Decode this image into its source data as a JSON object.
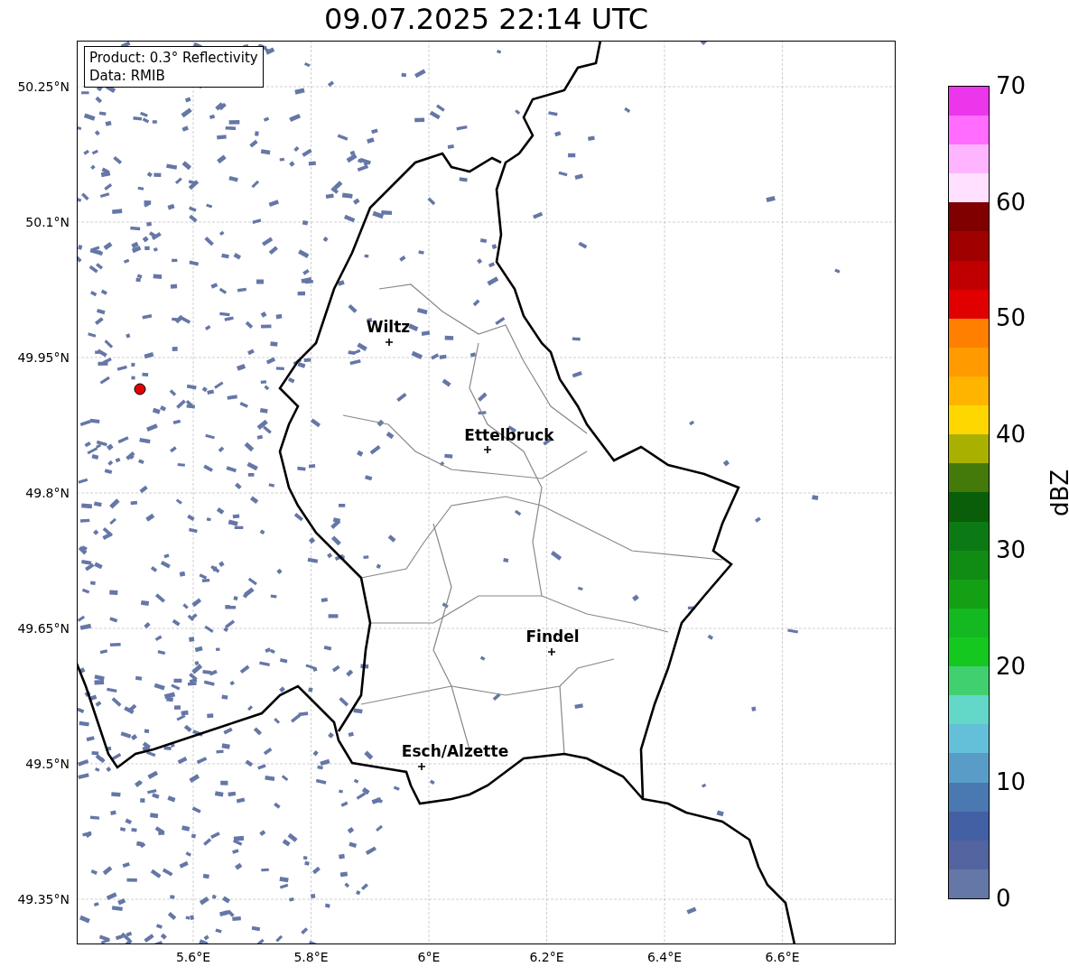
{
  "title": "09.07.2025 22:14 UTC",
  "info_box": [
    "Product: 0.3° Reflectivity",
    "Data: RMIB"
  ],
  "y_ticks": [
    "50.25°N",
    "50.1°N",
    "49.95°N",
    "49.8°N",
    "49.65°N",
    "49.5°N",
    "49.35°N"
  ],
  "x_ticks": [
    "5.6°E",
    "5.8°E",
    "6°E",
    "6.2°E",
    "6.4°E",
    "6.6°E"
  ],
  "cities": [
    {
      "name": "Wiltz"
    },
    {
      "name": "Ettelbruck"
    },
    {
      "name": "Findel"
    },
    {
      "name": "Esch/Alzette"
    }
  ],
  "colorbar": {
    "label": "dBZ",
    "ticks": [
      "70",
      "60",
      "50",
      "40",
      "30",
      "20",
      "10",
      "0"
    ],
    "bins": [
      {
        "color": "#6577a6"
      },
      {
        "color": "#5464a0"
      },
      {
        "color": "#4460a4"
      },
      {
        "color": "#4a78b0"
      },
      {
        "color": "#5a9cc8"
      },
      {
        "color": "#64c0d8"
      },
      {
        "color": "#64d8c8"
      },
      {
        "color": "#40d070"
      },
      {
        "color": "#14c820"
      },
      {
        "color": "#14b820"
      },
      {
        "color": "#14a014"
      },
      {
        "color": "#108c14"
      },
      {
        "color": "#0c7a14"
      },
      {
        "color": "#0a5e0a"
      },
      {
        "color": "#447a0a"
      },
      {
        "color": "#aab000"
      },
      {
        "color": "#ffd700"
      },
      {
        "color": "#ffb400"
      },
      {
        "color": "#ff9a00"
      },
      {
        "color": "#ff7f00"
      },
      {
        "color": "#e00000"
      },
      {
        "color": "#c00000"
      },
      {
        "color": "#a00000"
      },
      {
        "color": "#800000"
      },
      {
        "color": "#ffe0ff"
      },
      {
        "color": "#ffb4ff"
      },
      {
        "color": "#ff6cff"
      },
      {
        "color": "#ec36ec"
      }
    ]
  }
}
